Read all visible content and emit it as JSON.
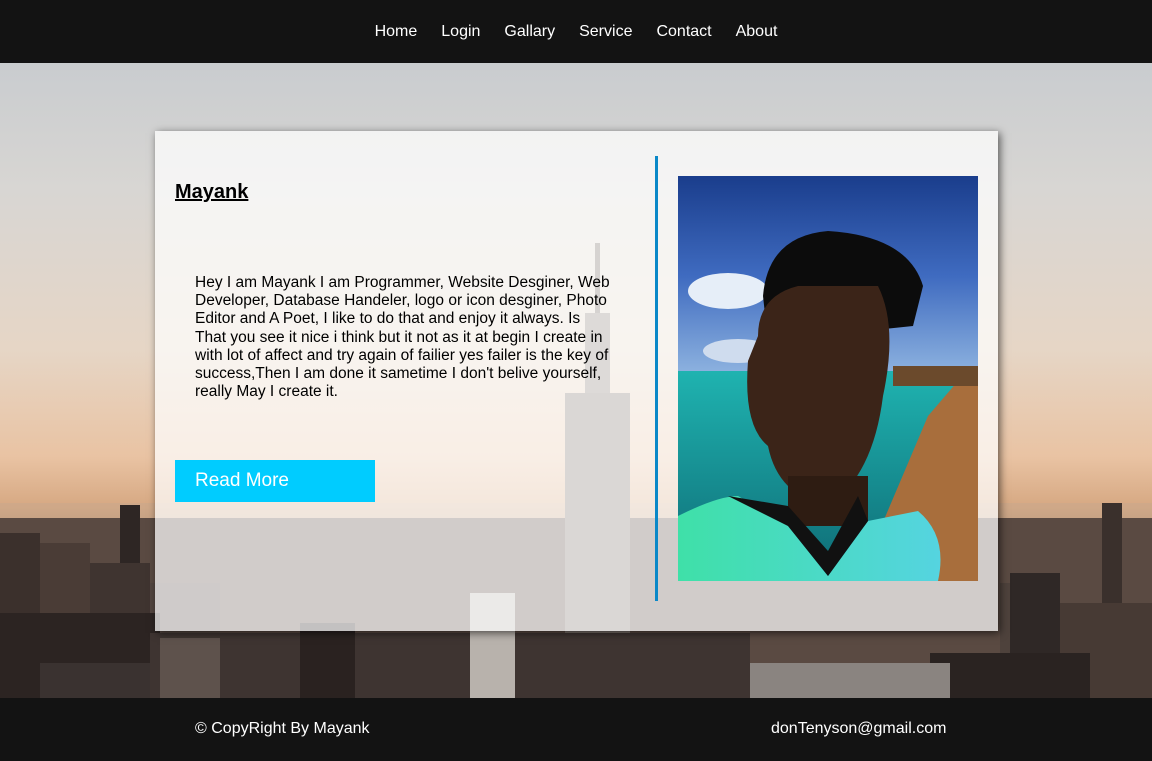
{
  "nav": {
    "items": [
      "Home",
      "Login",
      "Gallary",
      "Service",
      "Contact",
      "About"
    ]
  },
  "profile": {
    "name": "Mayank",
    "bio": "Hey I am Mayank I am Programmer, Website Desginer, Web Developer, Database Handeler, logo or icon desginer, Photo Editor and A Poet, I like to do that and enjoy it always. Is That you see it nice i think but it not as it at begin I create in with lot of affect and try again of failier yes failer is the key of success,Then I am done it sametime I don't belive yourself, really May I create it.",
    "read_more_label": "Read More"
  },
  "footer": {
    "copyright": "© CopyRight By Mayank",
    "email": "donTenyson@gmail.com"
  },
  "colors": {
    "bar": "#131313",
    "button": "#00ccff",
    "divider": "#0a88c8"
  }
}
